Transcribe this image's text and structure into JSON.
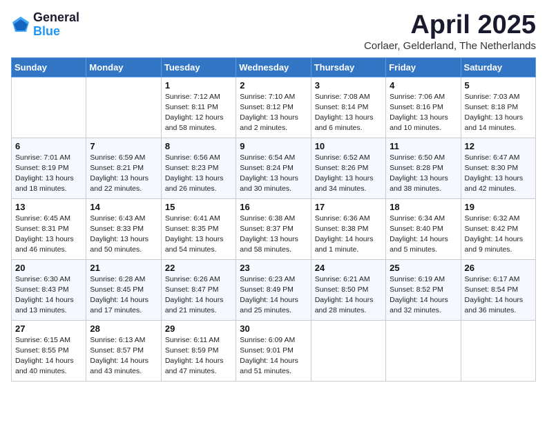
{
  "header": {
    "logo_general": "General",
    "logo_blue": "Blue",
    "month_title": "April 2025",
    "location": "Corlaer, Gelderland, The Netherlands"
  },
  "weekdays": [
    "Sunday",
    "Monday",
    "Tuesday",
    "Wednesday",
    "Thursday",
    "Friday",
    "Saturday"
  ],
  "weeks": [
    [
      {
        "day": "",
        "info": ""
      },
      {
        "day": "",
        "info": ""
      },
      {
        "day": "1",
        "info": "Sunrise: 7:12 AM\nSunset: 8:11 PM\nDaylight: 12 hours\nand 58 minutes."
      },
      {
        "day": "2",
        "info": "Sunrise: 7:10 AM\nSunset: 8:12 PM\nDaylight: 13 hours\nand 2 minutes."
      },
      {
        "day": "3",
        "info": "Sunrise: 7:08 AM\nSunset: 8:14 PM\nDaylight: 13 hours\nand 6 minutes."
      },
      {
        "day": "4",
        "info": "Sunrise: 7:06 AM\nSunset: 8:16 PM\nDaylight: 13 hours\nand 10 minutes."
      },
      {
        "day": "5",
        "info": "Sunrise: 7:03 AM\nSunset: 8:18 PM\nDaylight: 13 hours\nand 14 minutes."
      }
    ],
    [
      {
        "day": "6",
        "info": "Sunrise: 7:01 AM\nSunset: 8:19 PM\nDaylight: 13 hours\nand 18 minutes."
      },
      {
        "day": "7",
        "info": "Sunrise: 6:59 AM\nSunset: 8:21 PM\nDaylight: 13 hours\nand 22 minutes."
      },
      {
        "day": "8",
        "info": "Sunrise: 6:56 AM\nSunset: 8:23 PM\nDaylight: 13 hours\nand 26 minutes."
      },
      {
        "day": "9",
        "info": "Sunrise: 6:54 AM\nSunset: 8:24 PM\nDaylight: 13 hours\nand 30 minutes."
      },
      {
        "day": "10",
        "info": "Sunrise: 6:52 AM\nSunset: 8:26 PM\nDaylight: 13 hours\nand 34 minutes."
      },
      {
        "day": "11",
        "info": "Sunrise: 6:50 AM\nSunset: 8:28 PM\nDaylight: 13 hours\nand 38 minutes."
      },
      {
        "day": "12",
        "info": "Sunrise: 6:47 AM\nSunset: 8:30 PM\nDaylight: 13 hours\nand 42 minutes."
      }
    ],
    [
      {
        "day": "13",
        "info": "Sunrise: 6:45 AM\nSunset: 8:31 PM\nDaylight: 13 hours\nand 46 minutes."
      },
      {
        "day": "14",
        "info": "Sunrise: 6:43 AM\nSunset: 8:33 PM\nDaylight: 13 hours\nand 50 minutes."
      },
      {
        "day": "15",
        "info": "Sunrise: 6:41 AM\nSunset: 8:35 PM\nDaylight: 13 hours\nand 54 minutes."
      },
      {
        "day": "16",
        "info": "Sunrise: 6:38 AM\nSunset: 8:37 PM\nDaylight: 13 hours\nand 58 minutes."
      },
      {
        "day": "17",
        "info": "Sunrise: 6:36 AM\nSunset: 8:38 PM\nDaylight: 14 hours\nand 1 minute."
      },
      {
        "day": "18",
        "info": "Sunrise: 6:34 AM\nSunset: 8:40 PM\nDaylight: 14 hours\nand 5 minutes."
      },
      {
        "day": "19",
        "info": "Sunrise: 6:32 AM\nSunset: 8:42 PM\nDaylight: 14 hours\nand 9 minutes."
      }
    ],
    [
      {
        "day": "20",
        "info": "Sunrise: 6:30 AM\nSunset: 8:43 PM\nDaylight: 14 hours\nand 13 minutes."
      },
      {
        "day": "21",
        "info": "Sunrise: 6:28 AM\nSunset: 8:45 PM\nDaylight: 14 hours\nand 17 minutes."
      },
      {
        "day": "22",
        "info": "Sunrise: 6:26 AM\nSunset: 8:47 PM\nDaylight: 14 hours\nand 21 minutes."
      },
      {
        "day": "23",
        "info": "Sunrise: 6:23 AM\nSunset: 8:49 PM\nDaylight: 14 hours\nand 25 minutes."
      },
      {
        "day": "24",
        "info": "Sunrise: 6:21 AM\nSunset: 8:50 PM\nDaylight: 14 hours\nand 28 minutes."
      },
      {
        "day": "25",
        "info": "Sunrise: 6:19 AM\nSunset: 8:52 PM\nDaylight: 14 hours\nand 32 minutes."
      },
      {
        "day": "26",
        "info": "Sunrise: 6:17 AM\nSunset: 8:54 PM\nDaylight: 14 hours\nand 36 minutes."
      }
    ],
    [
      {
        "day": "27",
        "info": "Sunrise: 6:15 AM\nSunset: 8:55 PM\nDaylight: 14 hours\nand 40 minutes."
      },
      {
        "day": "28",
        "info": "Sunrise: 6:13 AM\nSunset: 8:57 PM\nDaylight: 14 hours\nand 43 minutes."
      },
      {
        "day": "29",
        "info": "Sunrise: 6:11 AM\nSunset: 8:59 PM\nDaylight: 14 hours\nand 47 minutes."
      },
      {
        "day": "30",
        "info": "Sunrise: 6:09 AM\nSunset: 9:01 PM\nDaylight: 14 hours\nand 51 minutes."
      },
      {
        "day": "",
        "info": ""
      },
      {
        "day": "",
        "info": ""
      },
      {
        "day": "",
        "info": ""
      }
    ]
  ]
}
